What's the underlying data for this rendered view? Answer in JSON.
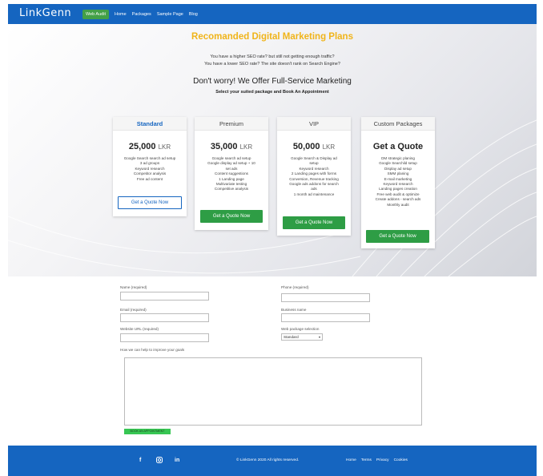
{
  "nav": {
    "logo": "LinkGenn",
    "links": [
      "Web Audit",
      "Home",
      "Packages",
      "Sample Page",
      "Blog"
    ]
  },
  "hero": {
    "title": "Recomanded Digital Marketing Plans",
    "line1": "You have a higher SEO rate? but still not getting enough traffic?",
    "line2": "You have a lower SEO rate? The site doesn't rank on Search Engine?",
    "heading": "Don't worry! We Offer Full-Service Marketing",
    "select": "Select your suited package and Book An Appointment"
  },
  "cards": [
    {
      "name": "Standard",
      "price": "25,000",
      "currency": "LKR",
      "features": [
        "Google Search search ad setup",
        "3 ad groups",
        "Keyword research",
        "Competitor analysis",
        "Free ad content"
      ],
      "button": "Get a Quote Now"
    },
    {
      "name": "Premium",
      "price": "35,000",
      "currency": "LKR",
      "features": [
        "Google search ad setup",
        "Google display ad setup + 10",
        "set ads",
        "Content suggestions",
        "1 Landing page",
        "Multivariate testing",
        "Competitive analysis"
      ],
      "button": "Get a Quote Now"
    },
    {
      "name": "VIP",
      "price": "50,000",
      "currency": "LKR",
      "features": [
        "Google Search & Display ad",
        "setup",
        "Keyword research",
        "2 Landing pages with forms",
        "Conversion, Revenue tracking",
        "Google ads addons for search",
        "ads",
        "1 month ad maintenance"
      ],
      "button": "Get a Quote Now"
    },
    {
      "name": "Custom Packages",
      "price": "Get a Quote",
      "currency": "",
      "features": [
        "DM strategic planing",
        "Google Searchild setup",
        "Display ad setup",
        "SMM planing",
        "E-mail marketing",
        "Keyword research",
        "Landing pages creation",
        "Free web audit & optimize",
        "Create addons - search ads",
        "Monthly audit"
      ],
      "button": "Get a Quote Now"
    }
  ],
  "form": {
    "name_label": "Name (required)",
    "phone_label": "Phone (required)",
    "email_label": "Email (required)",
    "business_label": "Business name",
    "website_label": "Website URL (required)",
    "package_label": "Web package selection",
    "package_value": "Standard",
    "goals_label": "How we can help to improve your goals",
    "submit_label": "BOOK AN APPOINTMENT"
  },
  "footer": {
    "copyright": "© LinkGenn 2020 All rights reserved.",
    "links": [
      "Home",
      "Terms",
      "Privacy",
      "Cookies"
    ],
    "social": [
      "f",
      "in"
    ]
  },
  "colors": {
    "brand_blue": "#1565c0",
    "accent_green": "#2e9d45",
    "title_yellow": "#f0b41a"
  }
}
